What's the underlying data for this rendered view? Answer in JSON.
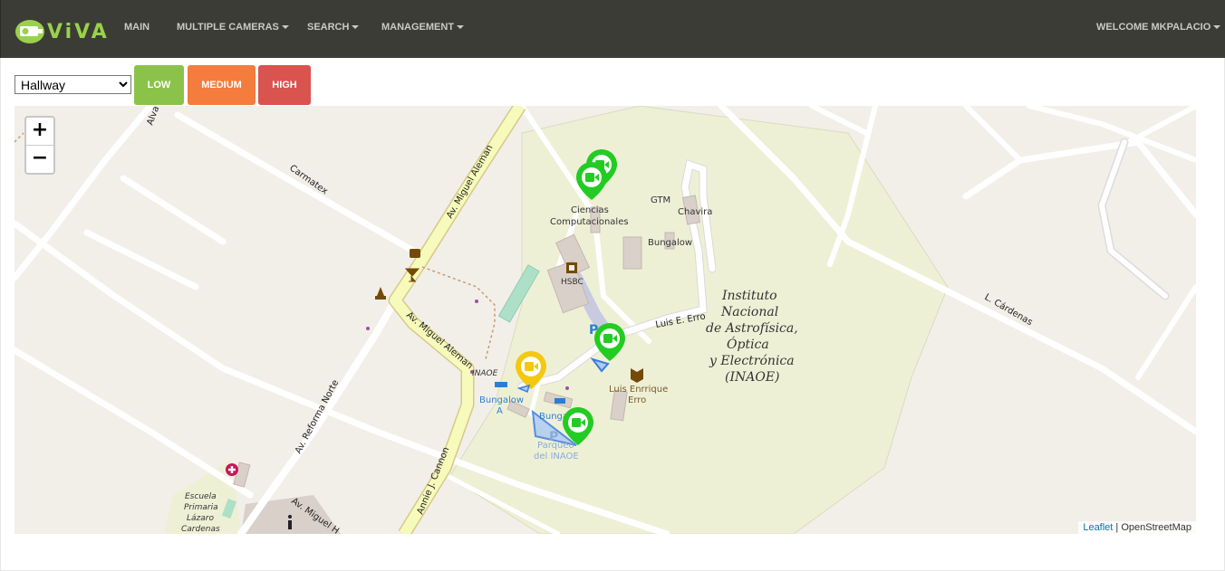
{
  "nav": {
    "brand": "ViVA",
    "items": [
      {
        "label": "MAIN"
      },
      {
        "label": "MULTIPLE CAMERAS"
      },
      {
        "label": "SEARCH"
      },
      {
        "label": "MANAGEMENT"
      }
    ],
    "user": "WELCOME MKPALACIO"
  },
  "controls": {
    "zone_select": {
      "selected": "Hallway",
      "options": [
        "Hallway"
      ]
    },
    "levels": [
      {
        "label": "LOW",
        "color": "#8bc34a"
      },
      {
        "label": "MEDIUM",
        "color": "#f47c3c"
      },
      {
        "label": "HIGH",
        "color": "#d9534f"
      }
    ]
  },
  "map": {
    "zoom_in": "+",
    "zoom_out": "−",
    "attribution": {
      "leaflet": "Leaflet",
      "separator": " | ",
      "osm": "OpenStreetMap"
    },
    "labels": {
      "miguel_aleman_1": "Av. Miguel Aleman",
      "miguel_aleman_2": "Av. Miguel Aleman",
      "miguel_aleman_3": "Av. Miguel H",
      "carmatex": "Carmatex",
      "alva": "Alva",
      "reforma": "Av. Reforma Norte",
      "annie": "Annie J. Cannon",
      "luis_erro": "Luis E. Erro",
      "cardenas": "L. Cárdenas",
      "inaoe_small": "INAOE",
      "gtm": "GTM",
      "chavira": "Chavira",
      "bungalow": "Bungalow",
      "ciencias_1": "Ciencias",
      "ciencias_2": "Computacionales",
      "hsbc": "HSBC",
      "bungalow_a_1": "Bungalow",
      "bungalow_a_2": "A",
      "bunga": "Bunga",
      "parqueo_1": "Parqueo",
      "parqueo_2": "del INAOE",
      "luis_enrrique_1": "Luis Enrrique",
      "luis_enrrique_2": "Erro",
      "inst_1": "Instituto",
      "inst_2": "Nacional",
      "inst_3": "de Astrofísica,",
      "inst_4": "Óptica",
      "inst_5": "y Electrónica",
      "inst_6": "(INAOE)",
      "escuela_1": "Escuela",
      "escuela_2": "Primaria",
      "escuela_3": "Lázaro",
      "escuela_4": "Cardenas",
      "parking": "P"
    },
    "camera_colors": {
      "active": "#22cc22",
      "alert": "#f4c811"
    }
  }
}
